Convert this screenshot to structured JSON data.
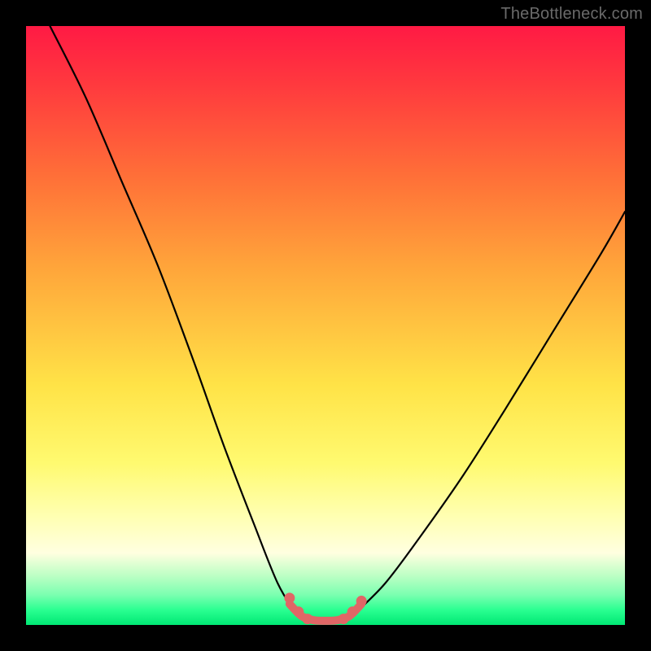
{
  "watermark": {
    "text": "TheBottleneck.com"
  },
  "chart_data": {
    "type": "line",
    "title": "",
    "xlabel": "",
    "ylabel": "",
    "xlim": [
      0,
      100
    ],
    "ylim": [
      0,
      100
    ],
    "grid": false,
    "legend": false,
    "series": [
      {
        "name": "left-curve",
        "stroke": "#000000",
        "x": [
          4,
          10,
          16,
          22,
          28,
          33,
          38,
          42,
          45
        ],
        "values": [
          100,
          88,
          74,
          60,
          44,
          30,
          17,
          7,
          2
        ]
      },
      {
        "name": "right-curve",
        "stroke": "#000000",
        "x": [
          55,
          60,
          66,
          73,
          80,
          88,
          96,
          100
        ],
        "values": [
          2,
          7,
          15,
          25,
          36,
          49,
          62,
          69
        ]
      },
      {
        "name": "valley-highlight",
        "stroke": "#e06666",
        "x": [
          44,
          46,
          48,
          50,
          52,
          54,
          56
        ],
        "values": [
          3.5,
          1.5,
          0.8,
          0.7,
          0.8,
          1.5,
          3.5
        ]
      }
    ],
    "markers": [
      {
        "x": 44,
        "y": 4.5,
        "color": "#e06666"
      },
      {
        "x": 45.5,
        "y": 2.2,
        "color": "#e06666"
      },
      {
        "x": 47,
        "y": 1.0,
        "color": "#e06666"
      },
      {
        "x": 53,
        "y": 1.0,
        "color": "#e06666"
      },
      {
        "x": 54.5,
        "y": 2.2,
        "color": "#e06666"
      },
      {
        "x": 56,
        "y": 4.0,
        "color": "#e06666"
      }
    ]
  }
}
